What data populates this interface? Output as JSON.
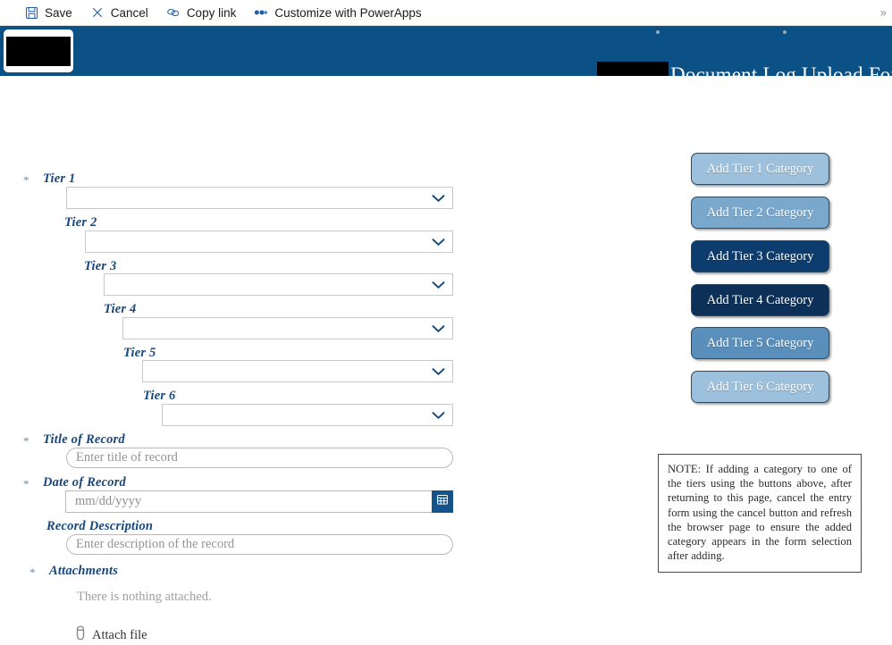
{
  "commandbar": {
    "items": [
      {
        "label": "Save",
        "icon": "save-icon"
      },
      {
        "label": "Cancel",
        "icon": "close-icon"
      },
      {
        "label": "Copy link",
        "icon": "link-icon"
      },
      {
        "label": "Customize with PowerApps",
        "icon": "powerapps-icon"
      }
    ],
    "overflow": "»"
  },
  "banner": {
    "title": "Document Log Upload Form",
    "background_color": "#0b5186",
    "logo_redacted": true,
    "title_redacted_box": true
  },
  "form": {
    "tiers": [
      {
        "label": "Tier 1",
        "required": true,
        "value": ""
      },
      {
        "label": "Tier 2",
        "required": false,
        "value": ""
      },
      {
        "label": "Tier 3",
        "required": false,
        "value": ""
      },
      {
        "label": "Tier 4",
        "required": false,
        "value": ""
      },
      {
        "label": "Tier 5",
        "required": false,
        "value": ""
      },
      {
        "label": "Tier 6",
        "required": false,
        "value": ""
      }
    ],
    "title_of_record": {
      "label": "Title of Record",
      "required": true,
      "placeholder": "Enter title of record",
      "value": ""
    },
    "date_of_record": {
      "label": "Date of Record",
      "required": true,
      "placeholder": "mm/dd/yyyy",
      "value": "",
      "calendar_icon": "calendar-icon"
    },
    "record_description": {
      "label": "Record Description",
      "required": false,
      "placeholder": "Enter description of the record",
      "value": ""
    },
    "attachments": {
      "label": "Attachments",
      "required": true,
      "empty_text": "There is nothing attached.",
      "attach_label": "Attach file",
      "attach_icon": "paperclip-icon"
    },
    "required_marker": "*"
  },
  "side_panel": {
    "buttons": [
      {
        "label": "Add Tier 1 Category",
        "color": "#9dc0dc"
      },
      {
        "label": "Add Tier 2 Category",
        "color": "#7aa8cd"
      },
      {
        "label": "Add Tier 3 Category",
        "color": "#0d3c6e"
      },
      {
        "label": "Add Tier 4 Category",
        "color": "#0d3058"
      },
      {
        "label": "Add Tier 5 Category",
        "color": "#5b8fbb"
      },
      {
        "label": "Add Tier 6 Category",
        "color": "#9dc0dc"
      }
    ],
    "note": "NOTE: If adding a category to one of the tiers using the buttons above, after returning to this page, cancel the entry form using the cancel button and refresh the browser page to ensure the added category appears in the form selection after adding."
  }
}
